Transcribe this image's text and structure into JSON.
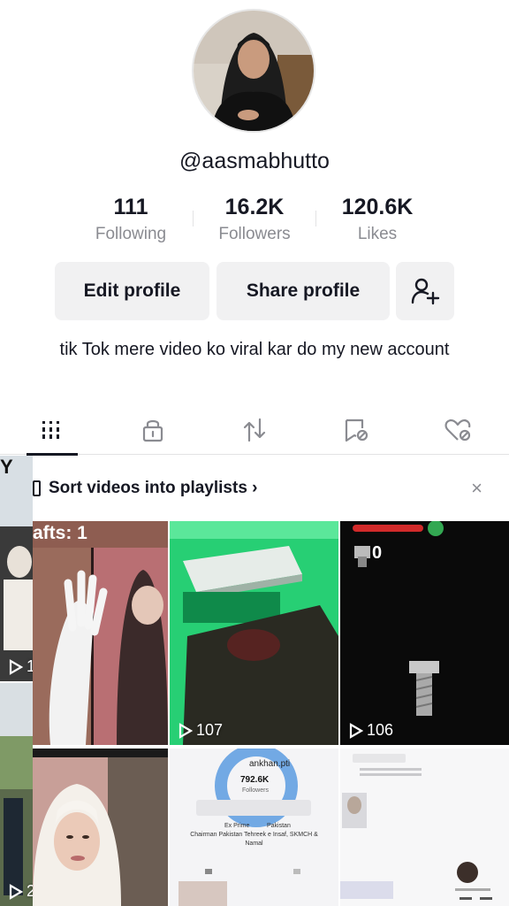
{
  "profile": {
    "username": "@aasmabhutto",
    "bio": "tik Tok mere video ko viral kar do my new account"
  },
  "stats": {
    "following": {
      "value": "111",
      "label": "Following"
    },
    "followers": {
      "value": "16.2K",
      "label": "Followers"
    },
    "likes": {
      "value": "120.6K",
      "label": "Likes"
    }
  },
  "actions": {
    "edit_profile": "Edit profile",
    "share_profile": "Share profile"
  },
  "tabs": [
    {
      "name": "videos-grid-icon"
    },
    {
      "name": "lock-icon"
    },
    {
      "name": "repost-icon"
    },
    {
      "name": "saved-icon"
    },
    {
      "name": "liked-icon"
    }
  ],
  "playlist_prompt": {
    "text": "Sort videos into playlists ›",
    "close": "×"
  },
  "videos": [
    {
      "views": "1",
      "overlay_text": "Y"
    },
    {
      "views": "",
      "overlay_text": "afts: 1"
    },
    {
      "views": "107"
    },
    {
      "views": "106"
    },
    {
      "views": "2"
    },
    {
      "views": ""
    },
    {
      "views": "",
      "overlay": {
        "handle": "ankhan.pti",
        "followers": "792.6K",
        "followers_label": "Followers",
        "bio_line1": "Ex Prime",
        "bio_line1b": "Pakistan",
        "bio_line2": "Chairman Pakistan Tehreek e Insaf, SKMCH &",
        "bio_line3": "Namal"
      }
    },
    {
      "views": ""
    }
  ],
  "colors": {
    "text_primary": "#161823",
    "text_secondary": "#8a8b91",
    "button_bg": "#f1f1f2"
  }
}
